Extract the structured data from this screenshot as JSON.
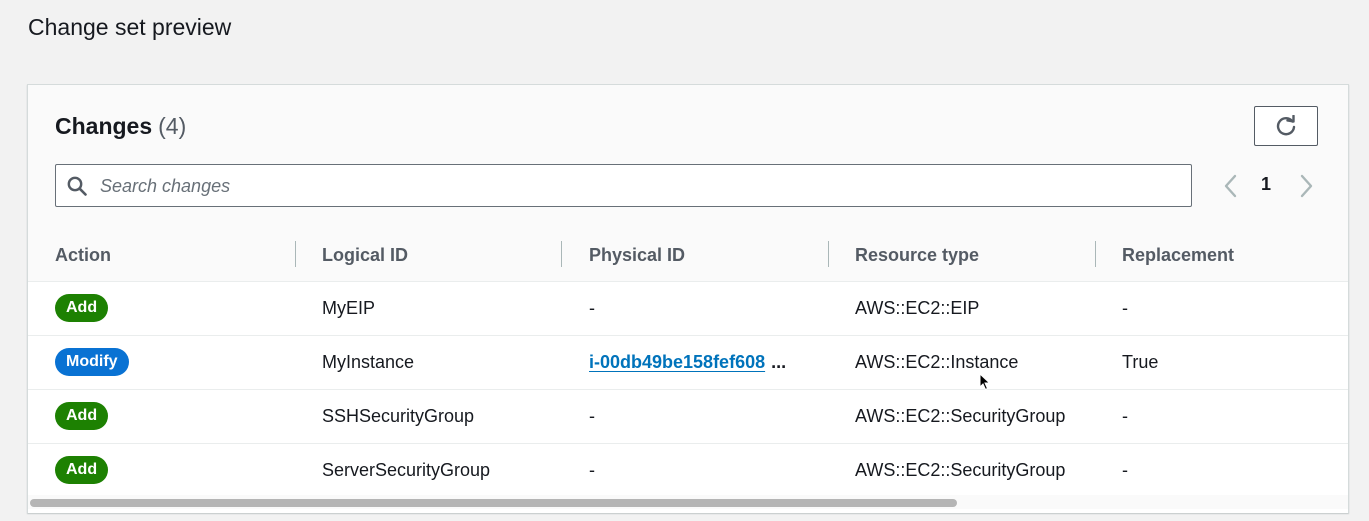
{
  "page": {
    "title": "Change set preview"
  },
  "changes": {
    "title": "Changes",
    "count": "(4)",
    "refresh_icon": "refresh-icon"
  },
  "search": {
    "placeholder": "Search changes",
    "value": ""
  },
  "pagination": {
    "current_page": "1"
  },
  "table": {
    "headers": {
      "action": "Action",
      "logical_id": "Logical ID",
      "physical_id": "Physical ID",
      "resource_type": "Resource type",
      "replacement": "Replacement"
    },
    "rows": [
      {
        "action": "Add",
        "logical_id": "MyEIP",
        "physical_id": "-",
        "resource_type": "AWS::EC2::EIP",
        "replacement": "-"
      },
      {
        "action": "Modify",
        "logical_id": "MyInstance",
        "physical_id": "i-00db49be158fef608",
        "physical_id_suffix": "...",
        "resource_type": "AWS::EC2::Instance",
        "replacement": "True"
      },
      {
        "action": "Add",
        "logical_id": "SSHSecurityGroup",
        "physical_id": "-",
        "resource_type": "AWS::EC2::SecurityGroup",
        "replacement": "-"
      },
      {
        "action": "Add",
        "logical_id": "ServerSecurityGroup",
        "physical_id": "-",
        "resource_type": "AWS::EC2::SecurityGroup",
        "replacement": "-"
      }
    ]
  },
  "colors": {
    "add_badge": "#1d8102",
    "modify_badge": "#0972d3",
    "link": "#0073bb"
  }
}
